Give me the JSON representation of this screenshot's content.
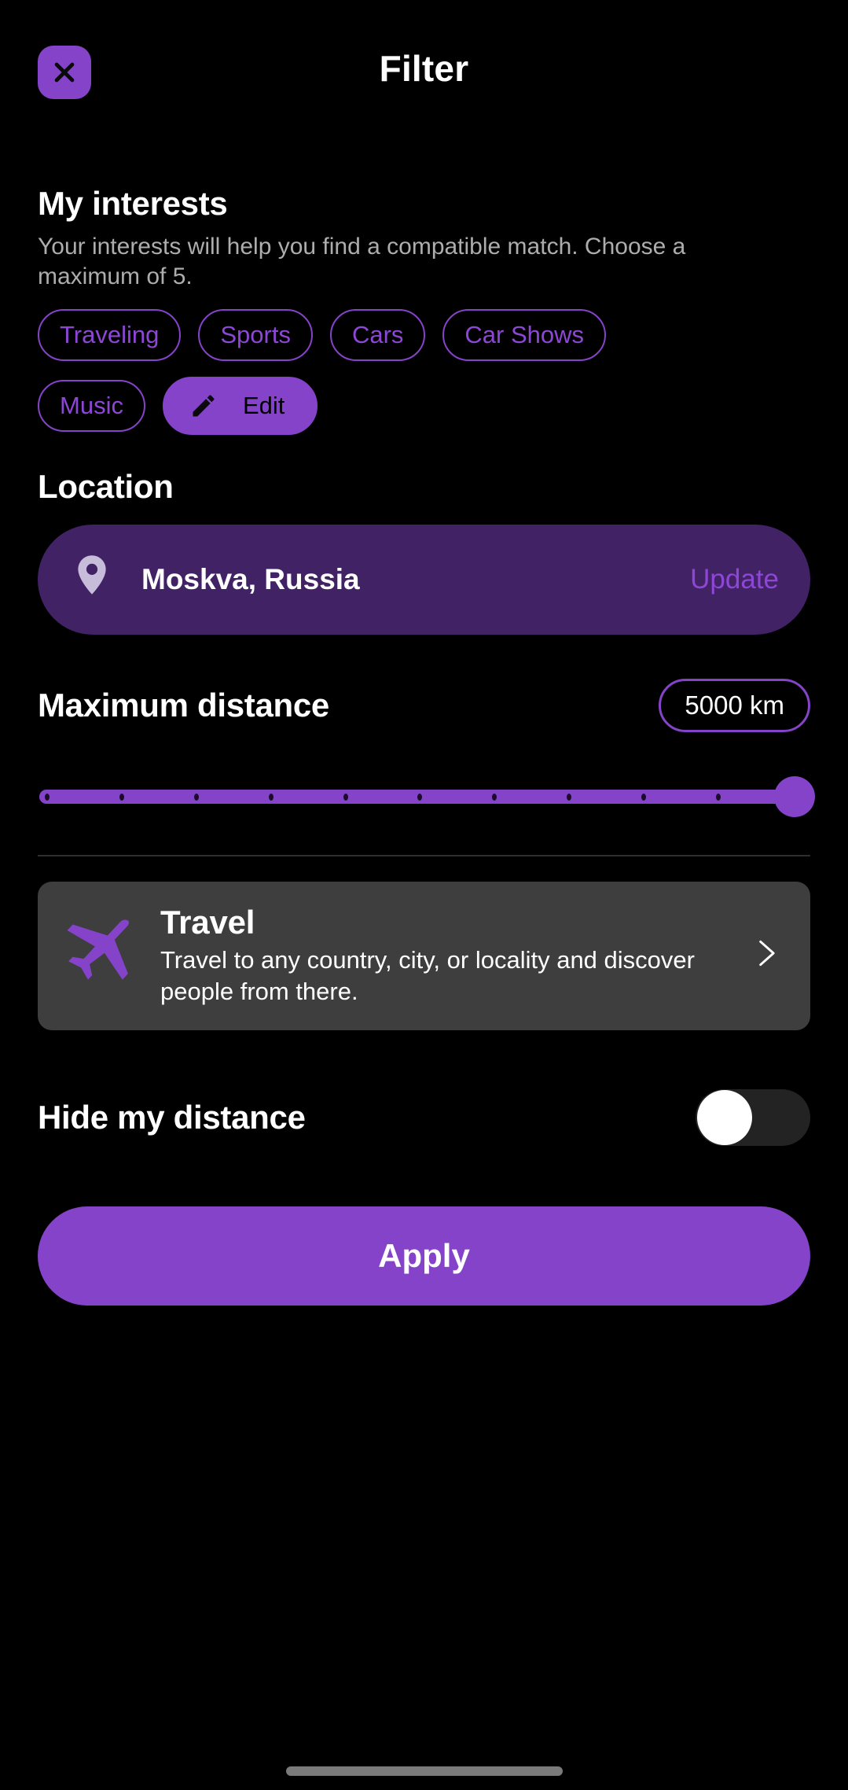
{
  "theme": {
    "background": "#000000",
    "accent_purple": "#8443C9",
    "accent_purple_text": "#8E46D6",
    "location_bar_bg": "#412265",
    "card_bg": "#3E3E3E",
    "muted_text": "#ADADAD",
    "toggle_off_track": "#232323",
    "divider": "#2E2E2E"
  },
  "header": {
    "title": "Filter",
    "close_icon": "close-x-icon"
  },
  "interests": {
    "title": "My interests",
    "description": "Your interests will help you find a compatible match. Choose a maximum of 5.",
    "max_selectable": 5,
    "rows": [
      [
        "Traveling",
        "Sports",
        "Cars",
        "Car Shows"
      ],
      [
        "Music"
      ]
    ],
    "chips": [
      "Traveling",
      "Sports",
      "Cars",
      "Car Shows",
      "Music"
    ],
    "edit": {
      "label": "Edit",
      "icon": "pencil-icon"
    }
  },
  "location": {
    "title": "Location",
    "pin_icon": "map-pin-icon",
    "value": "Moskva, Russia",
    "update_label": "Update"
  },
  "distance": {
    "title": "Maximum distance",
    "badge_value": "5000 km",
    "slider": {
      "value": 5000,
      "min": 0,
      "max": 5000,
      "percent": 100,
      "tick_count": 11
    }
  },
  "travel": {
    "icon": "airplane-icon",
    "title": "Travel",
    "description": "Travel to any country, city, or locality and discover people from there.",
    "chevron_icon": "chevron-right-icon"
  },
  "hide_distance": {
    "label": "Hide my distance",
    "enabled": false,
    "state_text": "off"
  },
  "footer": {
    "apply_label": "Apply"
  }
}
